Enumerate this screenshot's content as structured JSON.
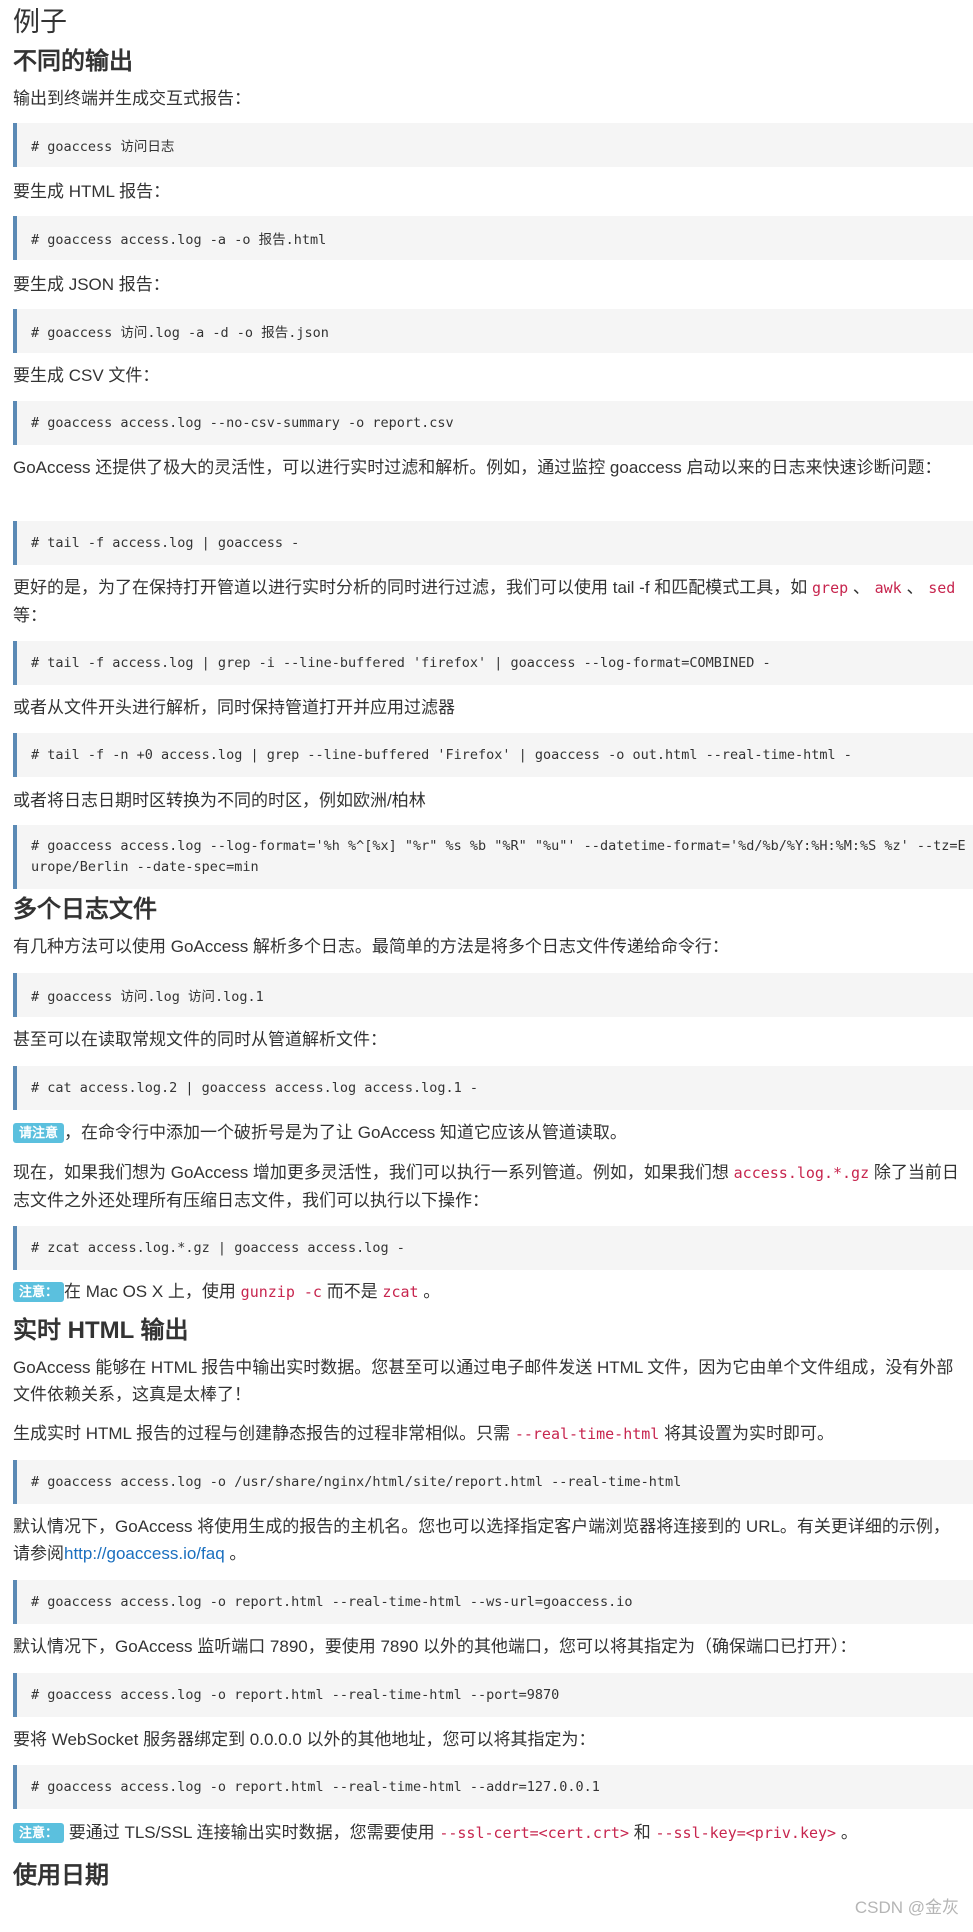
{
  "title": "例子",
  "section_outputs": {
    "heading": "不同的输出",
    "p_terminal": "输出到终端并生成交互式报告：",
    "code_terminal": "# goaccess 访问日志",
    "p_html": "要生成 HTML 报告：",
    "code_html": "# goaccess access.log -a -o 报告.html",
    "p_json": "要生成 JSON 报告：",
    "code_json": "# goaccess 访问.log -a -d -o 报告.json",
    "p_csv": "要生成 CSV 文件：",
    "code_csv": "# goaccess access.log --no-csv-summary -o report.csv",
    "p_flex": "GoAccess 还提供了极大的灵活性，可以进行实时过滤和解析。例如，通过监控 goaccess 启动以来的日志来快速诊断问题：",
    "code_tail": "# tail -f access.log | goaccess -",
    "p_better_a": "更好的是，为了在保持打开管道以进行实时分析的同时进行过滤，我们可以使用 tail -f 和匹配模式工具，如",
    "p_better_grep": "grep",
    "p_better_sep1": "、",
    "p_better_awk": "awk",
    "p_better_sep2": "、",
    "p_better_sed": "sed",
    "p_better_end": "等：",
    "code_grep": "# tail -f access.log | grep -i --line-buffered 'firefox' | goaccess --log-format=COMBINED -",
    "p_parse": "或者从文件开头进行解析，同时保持管道打开并应用过滤器",
    "code_parse": "# tail -f -n +0 access.log | grep --line-buffered 'Firefox' | goaccess -o out.html --real-time-html -",
    "p_tz": "或者将日志日期时区转换为不同的时区，例如欧洲/柏林",
    "code_tz": "# goaccess access.log --log-format='%h %^[%x] \"%r\" %s %b \"%R\" \"%u\"' --datetime-format='%d/%b/%Y:%H:%M:%S %z' --tz=Europe/Berlin --date-spec=min"
  },
  "section_multi": {
    "heading": "多个日志文件",
    "p_ways": "有几种方法可以使用 GoAccess 解析多个日志。最简单的方法是将多个日志文件传递给命令行：",
    "code_multi": "# goaccess 访问.log 访问.log.1",
    "p_pipe": "甚至可以在读取常规文件的同时从管道解析文件：",
    "code_pipe": "# cat access.log.2 | goaccess access.log access.log.1 -",
    "note_label": "请注意",
    "note_text": "，在命令行中添加一个破折号是为了让 GoAccess 知道它应该从管道读取。",
    "p_more_a": "现在，如果我们想为 GoAccess 增加更多灵活性，我们可以执行一系列管道。例如，如果我们想",
    "p_more_code": "access.log.*.gz",
    "p_more_b": "除了当前日志文件之外还处理所有压缩日志文件，我们可以执行以下操作：",
    "code_zcat": "# zcat access.log.*.gz | goaccess access.log -",
    "note2_label": "注意：",
    "note2_a": "在 Mac OS X 上，使用",
    "note2_code1": "gunzip -c",
    "note2_b": "而不是",
    "note2_code2": "zcat",
    "note2_c": "。"
  },
  "section_realtime": {
    "heading": "实时 HTML 输出",
    "p_intro": "GoAccess 能够在 HTML 报告中输出实时数据。您甚至可以通过电子邮件发送 HTML 文件，因为它由单个文件组成，没有外部文件依赖关系，这真是太棒了！",
    "p_gen_a": "生成实时 HTML 报告的过程与创建静态报告的过程非常相似。只需",
    "p_gen_code": "--real-time-html",
    "p_gen_b": "将其设置为实时即可。",
    "code_gen": "# goaccess access.log -o /usr/share/nginx/html/site/report.html --real-time-html",
    "p_host_a": "默认情况下，GoAccess 将使用生成的报告的主机名。您也可以选择指定客户端浏览器将连接到的 URL。有关更详细的示例， 请参阅",
    "p_host_link": "http://goaccess.io/faq",
    "p_host_b": "。",
    "code_ws": "# goaccess access.log -o report.html --real-time-html --ws-url=goaccess.io",
    "p_port": "默认情况下，GoAccess 监听端口 7890，要使用 7890 以外的其他端口，您可以将其指定为（确保端口已打开）：",
    "code_port": "# goaccess access.log -o report.html --real-time-html --port=9870",
    "p_addr": "要将 WebSocket 服务器绑定到 0.0.0.0 以外的其他地址，您可以将其指定为：",
    "code_addr": "# goaccess access.log -o report.html --real-time-html --addr=127.0.0.1",
    "note3_label": "注意：",
    "note3_a": "要通过 TLS/SSL 连接输出实时数据，您需要使用",
    "note3_code1": "--ssl-cert=<cert.crt>",
    "note3_b": "和",
    "note3_code2": "--ssl-key=<priv.key>",
    "note3_c": "。"
  },
  "section_dates": {
    "heading": "使用日期"
  },
  "watermark": "CSDN @金灰"
}
